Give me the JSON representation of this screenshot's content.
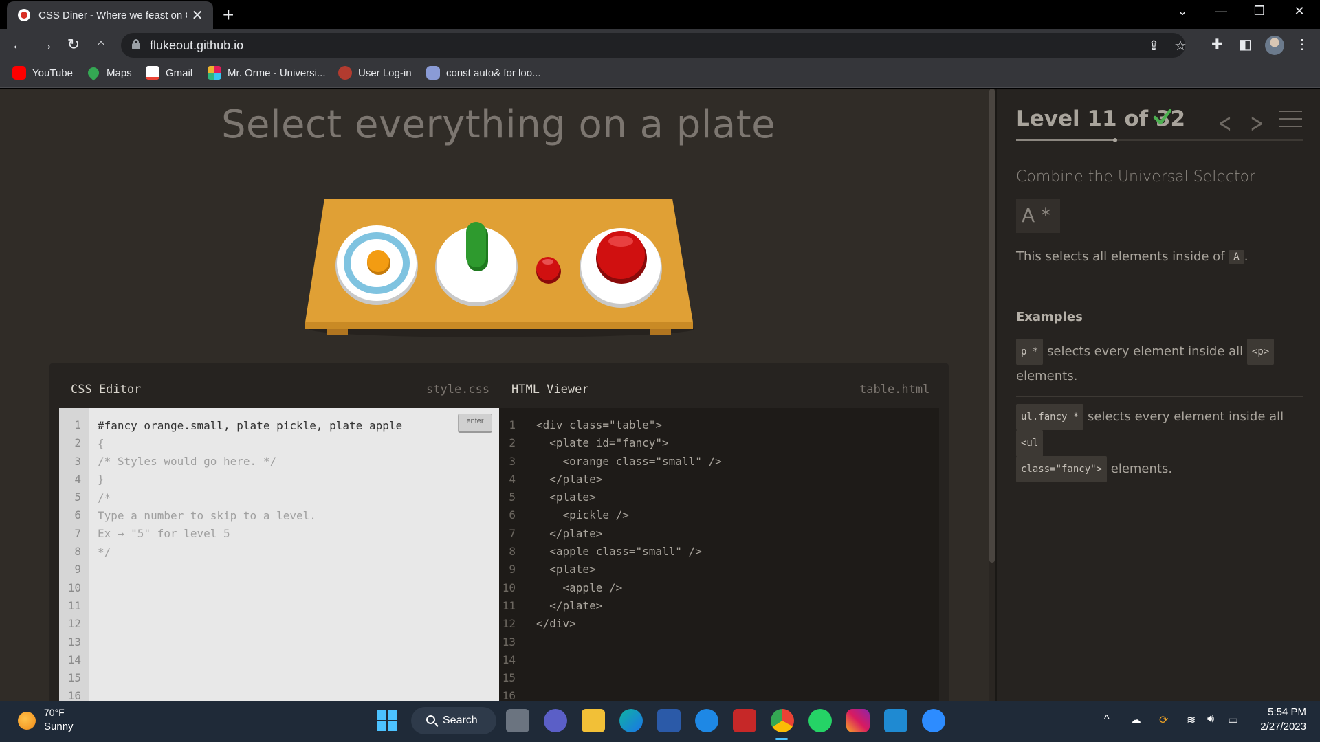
{
  "browser": {
    "tab_title": "CSS Diner - Where we feast on C",
    "tab_close": "✕",
    "new_tab": "+",
    "url": "flukeout.github.io",
    "bookmarks": [
      {
        "label": "YouTube",
        "icon": "youtube-icon",
        "color": "#ff0000"
      },
      {
        "label": "Maps",
        "icon": "maps-icon",
        "color": "#34a853"
      },
      {
        "label": "Gmail",
        "icon": "gmail-icon",
        "color": "#ea4335"
      },
      {
        "label": "Mr. Orme - Universi...",
        "icon": "slack-icon",
        "color": "#e01e5a"
      },
      {
        "label": "User Log-in",
        "icon": "user-login-icon",
        "color": "#b23b2f"
      },
      {
        "label": "const auto& for loo...",
        "icon": "discord-icon",
        "color": "#8a9bd6"
      }
    ]
  },
  "game": {
    "title": "Select everything on a plate"
  },
  "css_editor": {
    "title": "CSS Editor",
    "file": "style.css",
    "input_value": "#fancy orange.small, plate pickle, plate apple",
    "enter_label": "enter",
    "lines": [
      "{",
      "/* Styles would go here. */",
      "}",
      "",
      "/*",
      "Type a number to skip to a level.",
      "Ex → \"5\" for level 5",
      "*/",
      "",
      "",
      "",
      "",
      "",
      "",
      ""
    ],
    "line_numbers": [
      "1",
      "2",
      "3",
      "4",
      "5",
      "6",
      "7",
      "8",
      "9",
      "10",
      "11",
      "12",
      "13",
      "14",
      "15",
      "16"
    ]
  },
  "html_viewer": {
    "title": "HTML Viewer",
    "file": "table.html",
    "lines": [
      "<div class=\"table\">",
      "  <plate id=\"fancy\">",
      "    <orange class=\"small\" />",
      "  </plate>",
      "  <plate>",
      "    <pickle />",
      "  </plate>",
      "  <apple class=\"small\" />",
      "  <plate>",
      "    <apple />",
      "  </plate>",
      "</div>",
      "",
      "",
      "",
      ""
    ],
    "line_numbers": [
      "1",
      "2",
      "3",
      "4",
      "5",
      "6",
      "7",
      "8",
      "9",
      "10",
      "11",
      "12",
      "13",
      "14",
      "15",
      "16"
    ]
  },
  "sidebar": {
    "level_label": "Level 11 of 32",
    "progress_fraction": 0.34375,
    "selector_name": "Combine the Universal Selector",
    "syntax": "A *",
    "description_prefix": "This selects all elements inside of",
    "description_code": "A",
    "description_suffix": ".",
    "examples_title": "Examples",
    "examples": [
      {
        "code": "p *",
        "text": "selects every element inside all",
        "code2": "<p>",
        "text2": "elements."
      },
      {
        "code": "ul.fancy *",
        "text": "selects every element inside all",
        "code2": "<ul",
        "code3": "class=\"fancy\">",
        "text2": "elements."
      }
    ]
  },
  "taskbar": {
    "temperature": "70°F",
    "weather": "Sunny",
    "search_label": "Search",
    "time": "5:54 PM",
    "date": "2/27/2023"
  },
  "colors": {
    "page_bg": "#302c27",
    "table_wood": "#e0a035",
    "check_green": "#4caf50",
    "apple_red": "#d01010",
    "pickle_green": "#2e9a2e",
    "orange": "#f39c12"
  }
}
